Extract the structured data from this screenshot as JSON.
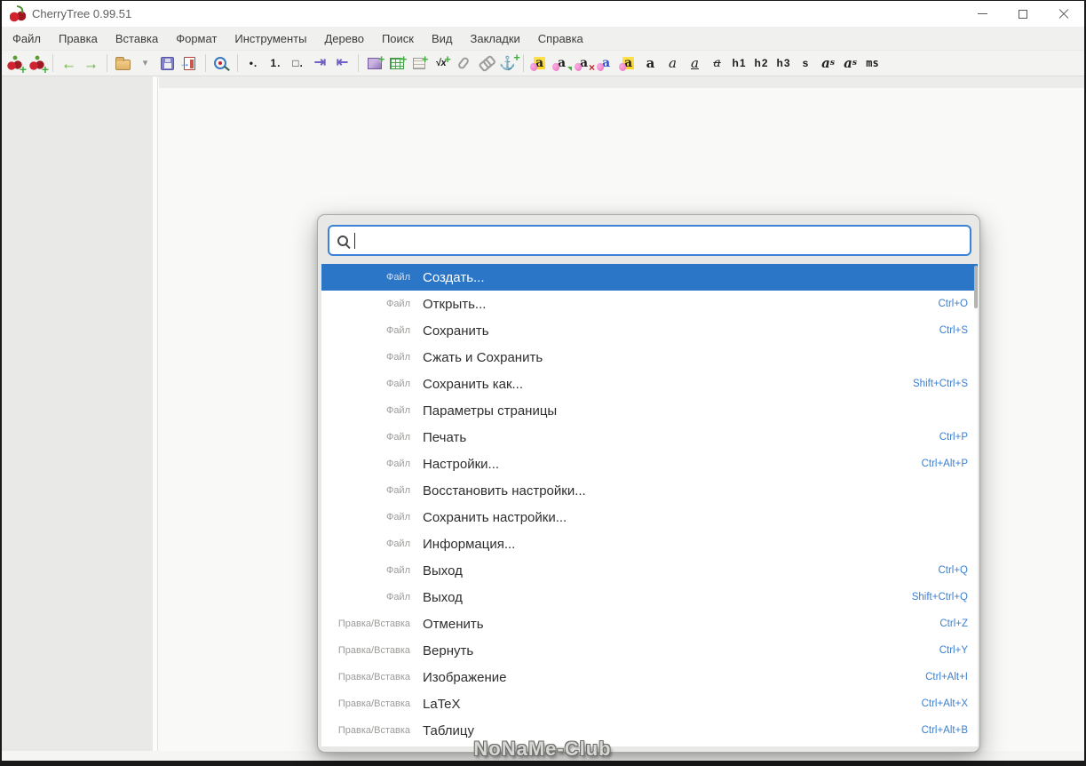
{
  "colors": {
    "selection_blue": "#2b76c7",
    "shortcut_blue": "#3b7fd0"
  },
  "window": {
    "title": "CherryTree 0.99.51"
  },
  "menubar": {
    "items": [
      {
        "name": "menu-file",
        "label": "Файл"
      },
      {
        "name": "menu-edit",
        "label": "Правка"
      },
      {
        "name": "menu-insert",
        "label": "Вставка"
      },
      {
        "name": "menu-format",
        "label": "Формат"
      },
      {
        "name": "menu-tools",
        "label": "Инструменты"
      },
      {
        "name": "menu-tree",
        "label": "Дерево"
      },
      {
        "name": "menu-search",
        "label": "Поиск"
      },
      {
        "name": "menu-view",
        "label": "Вид"
      },
      {
        "name": "menu-bookmarks",
        "label": "Закладки"
      },
      {
        "name": "menu-help",
        "label": "Справка"
      }
    ]
  },
  "toolbar": {
    "items": [
      {
        "name": "new-node",
        "icon": "cherry-plus"
      },
      {
        "name": "new-subnode",
        "icon": "cherry-sub-plus"
      },
      {
        "sep": true
      },
      {
        "name": "go-back",
        "icon": "arrow-left",
        "glyph": "←"
      },
      {
        "name": "go-forward",
        "icon": "arrow-right",
        "glyph": "→"
      },
      {
        "sep": true
      },
      {
        "name": "open-file",
        "icon": "folder"
      },
      {
        "name": "open-recent",
        "icon": "caret-down",
        "glyph": "▾"
      },
      {
        "name": "save",
        "icon": "floppy"
      },
      {
        "name": "save-as",
        "icon": "save-as"
      },
      {
        "sep": true
      },
      {
        "name": "find-node",
        "icon": "magnifier"
      },
      {
        "sep": true
      },
      {
        "name": "bullet-list",
        "icon": "text",
        "glyph": "•."
      },
      {
        "name": "numbered-list",
        "icon": "text",
        "glyph": "1."
      },
      {
        "name": "todo-list",
        "icon": "text",
        "glyph": "□."
      },
      {
        "name": "indent-more",
        "icon": "indent-right",
        "glyph": "⇥"
      },
      {
        "name": "indent-less",
        "icon": "indent-left",
        "glyph": "⇤"
      },
      {
        "sep": true
      },
      {
        "name": "insert-image",
        "icon": "image-plus"
      },
      {
        "name": "insert-table",
        "icon": "table-plus"
      },
      {
        "name": "insert-codebox",
        "icon": "codebox-plus"
      },
      {
        "name": "insert-latex",
        "icon": "latex-plus",
        "glyph": "√x"
      },
      {
        "name": "attach-file",
        "icon": "paperclip"
      },
      {
        "name": "insert-link",
        "icon": "chain"
      },
      {
        "name": "insert-anchor",
        "icon": "anchor",
        "glyph": "⚓"
      },
      {
        "sep": true
      },
      {
        "name": "format-latest",
        "icon": "fmt-latest",
        "fmt": true,
        "glyph": "a"
      },
      {
        "name": "format-apply",
        "icon": "fmt-apply",
        "fmt": true,
        "glyph": "a"
      },
      {
        "name": "format-clear",
        "icon": "fmt-clear",
        "fmt": true,
        "glyph": "a"
      },
      {
        "name": "color-foreground",
        "icon": "fmt-fg",
        "fmt": true,
        "glyph": "a"
      },
      {
        "name": "color-background",
        "icon": "fmt-bg",
        "fmt": true,
        "glyph": "a"
      },
      {
        "name": "bold",
        "icon": "text-bold",
        "glyph": "a"
      },
      {
        "name": "italic",
        "icon": "text-italic",
        "glyph": "a"
      },
      {
        "name": "underline",
        "icon": "text-underline",
        "glyph": "a"
      },
      {
        "name": "strikethrough",
        "icon": "text-strike",
        "glyph": "a"
      },
      {
        "name": "heading-1",
        "icon": "text",
        "glyph": "h1"
      },
      {
        "name": "heading-2",
        "icon": "text",
        "glyph": "h2"
      },
      {
        "name": "heading-3",
        "icon": "text",
        "glyph": "h3"
      },
      {
        "name": "small-text",
        "icon": "text",
        "glyph": "s"
      },
      {
        "name": "superscript",
        "icon": "sup",
        "glyph": "a"
      },
      {
        "name": "subscript",
        "icon": "sub",
        "glyph": "a"
      },
      {
        "name": "monospace",
        "icon": "text-mono",
        "glyph": "ms"
      }
    ]
  },
  "palette": {
    "search": {
      "value": "",
      "placeholder": ""
    },
    "items": [
      {
        "category": "Файл",
        "label": "Создать...",
        "shortcut": "",
        "selected": true
      },
      {
        "category": "Файл",
        "label": "Открыть...",
        "shortcut": "Ctrl+O"
      },
      {
        "category": "Файл",
        "label": "Сохранить",
        "shortcut": "Ctrl+S"
      },
      {
        "category": "Файл",
        "label": "Сжать и Сохранить",
        "shortcut": ""
      },
      {
        "category": "Файл",
        "label": "Сохранить как...",
        "shortcut": "Shift+Ctrl+S"
      },
      {
        "category": "Файл",
        "label": "Параметры страницы",
        "shortcut": ""
      },
      {
        "category": "Файл",
        "label": "Печать",
        "shortcut": "Ctrl+P"
      },
      {
        "category": "Файл",
        "label": "Настройки...",
        "shortcut": "Ctrl+Alt+P"
      },
      {
        "category": "Файл",
        "label": "Восстановить настройки...",
        "shortcut": ""
      },
      {
        "category": "Файл",
        "label": "Сохранить настройки...",
        "shortcut": ""
      },
      {
        "category": "Файл",
        "label": "Информация...",
        "shortcut": ""
      },
      {
        "category": "Файл",
        "label": "Выход",
        "shortcut": "Ctrl+Q"
      },
      {
        "category": "Файл",
        "label": "Выход",
        "shortcut": "Shift+Ctrl+Q"
      },
      {
        "category": "Правка/Вставка",
        "label": "Отменить",
        "shortcut": "Ctrl+Z"
      },
      {
        "category": "Правка/Вставка",
        "label": "Вернуть",
        "shortcut": "Ctrl+Y"
      },
      {
        "category": "Правка/Вставка",
        "label": "Изображение",
        "shortcut": "Ctrl+Alt+I"
      },
      {
        "category": "Правка/Вставка",
        "label": "LaTeX",
        "shortcut": "Ctrl+Alt+X"
      },
      {
        "category": "Правка/Вставка",
        "label": "Таблицу",
        "shortcut": "Ctrl+Alt+B"
      }
    ]
  },
  "watermark": {
    "text": "NoNaMe-Club"
  }
}
